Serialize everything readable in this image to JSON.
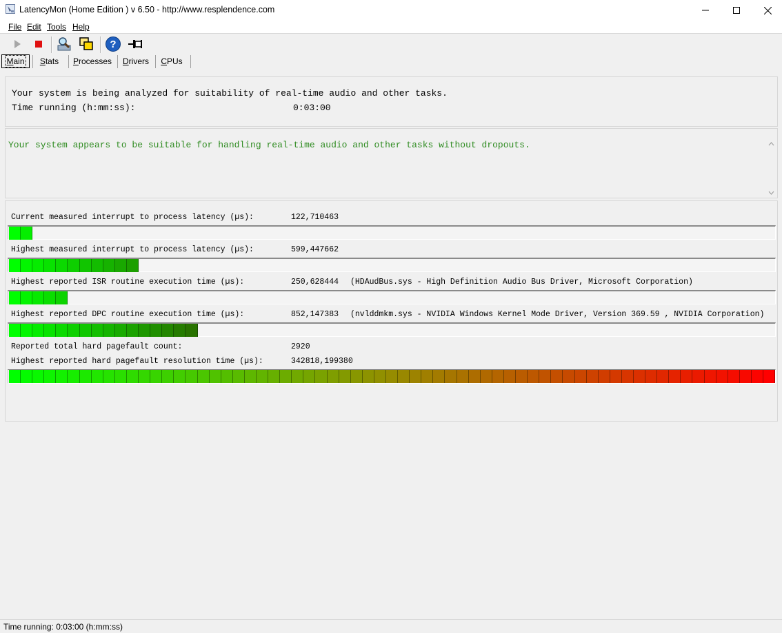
{
  "window": {
    "title": "LatencyMon  (Home Edition )  v 6.50 - http://www.resplendence.com"
  },
  "menu": [
    "File",
    "Edit",
    "Tools",
    "Help"
  ],
  "toolbar": {
    "icons": [
      "play-icon",
      "stop-icon",
      "analyze-icon",
      "windows-icon",
      "help-icon",
      "pin-icon"
    ]
  },
  "tabs": [
    "Main",
    "Stats",
    "Processes",
    "Drivers",
    "CPUs"
  ],
  "summary": {
    "analyzing": "Your system is being analyzed for suitability of real-time audio and other tasks.",
    "time_label": "Time running (h:mm:ss):",
    "time_value": "0:03:00"
  },
  "conclusion": {
    "text": "Your system appears to be suitable for handling real-time audio and other tasks without dropouts.",
    "color": "#2e8b20"
  },
  "metrics": [
    {
      "label": "Current measured interrupt to process latency (µs):",
      "value": "122,710463",
      "detail": "",
      "meter_segments": 2
    },
    {
      "label": "Highest measured interrupt to process latency (µs):",
      "value": "599,447662",
      "detail": "",
      "meter_segments": 11
    },
    {
      "label": "Highest reported ISR routine execution time (µs):",
      "value": "250,628444",
      "detail": "(HDAudBus.sys - High Definition Audio Bus Driver, Microsoft Corporation)",
      "meter_segments": 5
    },
    {
      "label": "Highest reported DPC routine execution time (µs):",
      "value": "852,147383",
      "detail": "(nvlddmkm.sys - NVIDIA Windows Kernel Mode Driver, Version 369.59 , NVIDIA Corporation)",
      "meter_segments": 16
    }
  ],
  "pagefault": {
    "count_label": "Reported total hard pagefault count:",
    "count_value": "2920",
    "time_label": "Highest reported hard pagefault resolution time (µs):",
    "time_value": "342818,199380",
    "meter_segments": 65
  },
  "meter": {
    "total_segments": 65,
    "start_color": "#00ff00",
    "end_color": "#ff0000"
  },
  "status": {
    "text": "Time running: 0:03:00  (h:mm:ss)"
  }
}
